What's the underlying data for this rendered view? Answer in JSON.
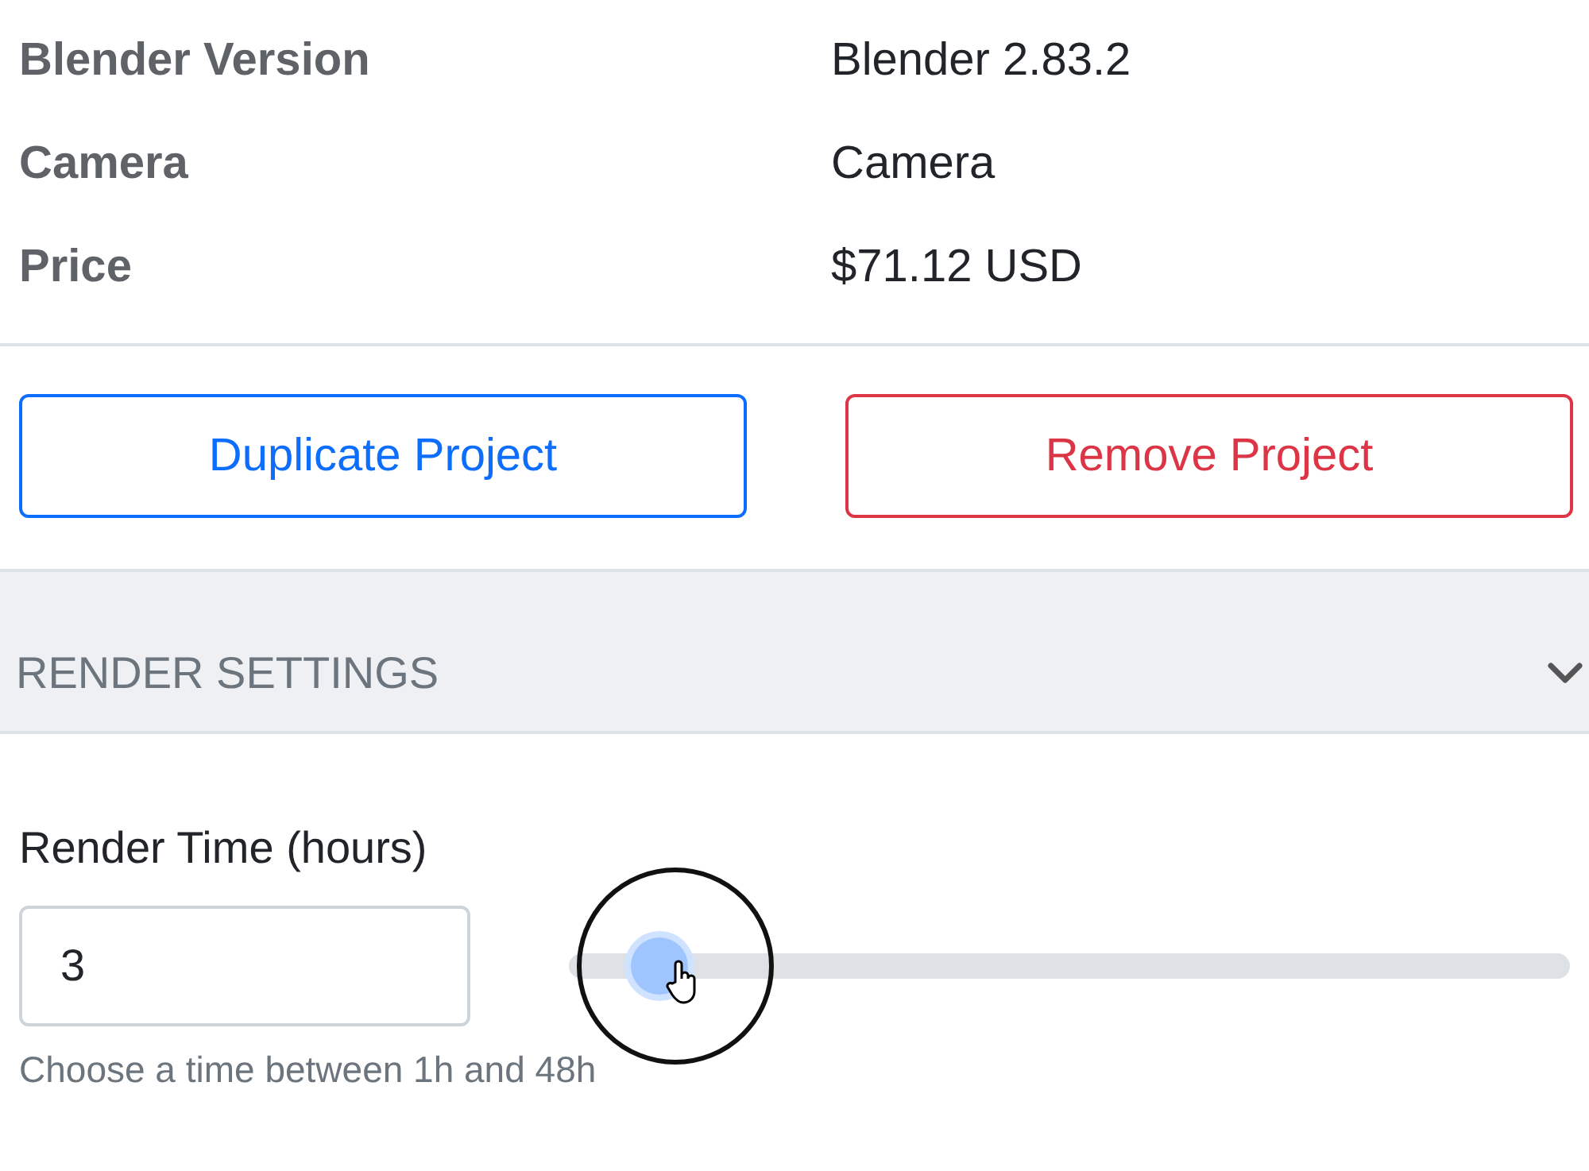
{
  "details": [
    {
      "label": "Blender Version",
      "value": "Blender 2.83.2"
    },
    {
      "label": "Camera",
      "value": "Camera"
    },
    {
      "label": "Price",
      "value": "$71.12 USD"
    }
  ],
  "actions": [
    {
      "label": "Duplicate Project",
      "kind": "primary"
    },
    {
      "label": "Remove Project",
      "kind": "danger"
    }
  ],
  "section": {
    "title": "RENDER SETTINGS",
    "expanded": true
  },
  "render_time": {
    "label": "Render Time (hours)",
    "value": "3",
    "level": 0.04,
    "help": "Choose a time between 1h and 48h"
  }
}
